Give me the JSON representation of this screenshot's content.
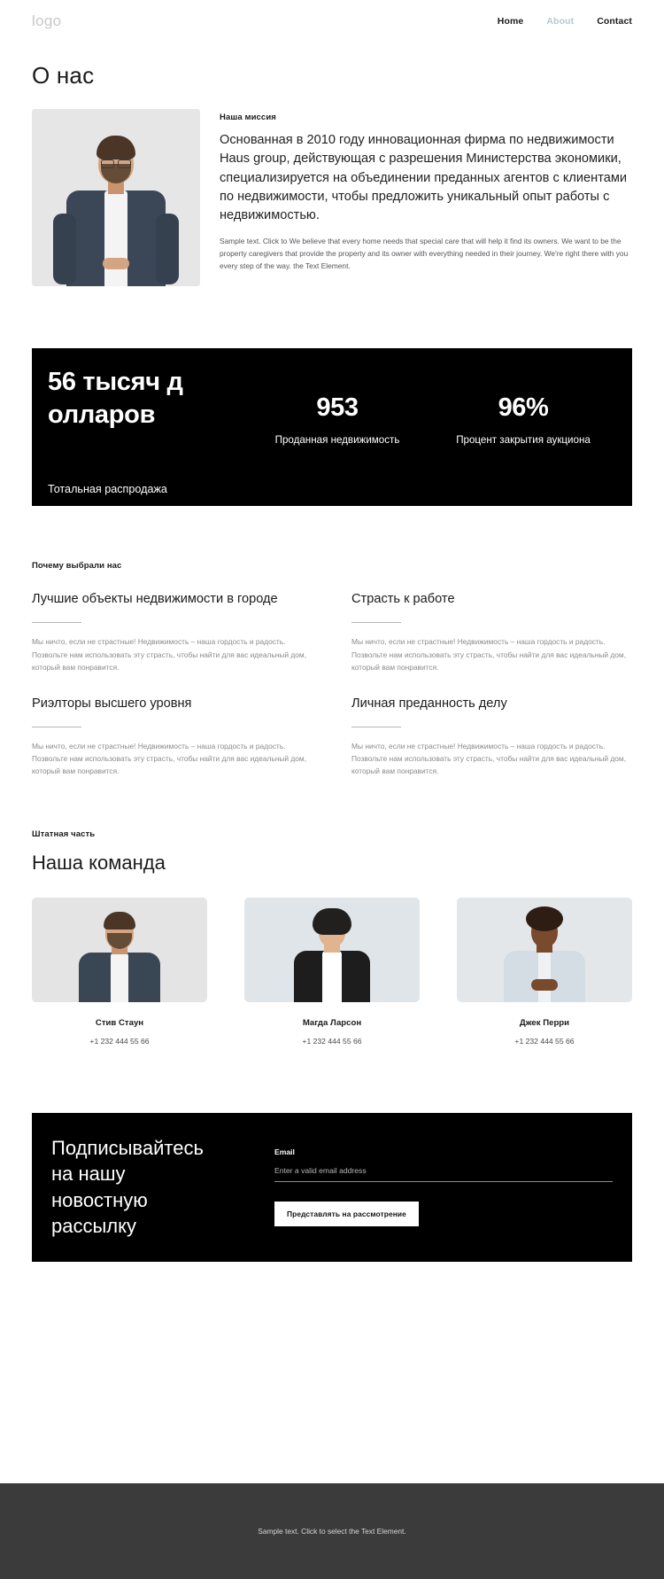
{
  "header": {
    "logo": "logo",
    "nav": [
      {
        "label": "Home",
        "active": false
      },
      {
        "label": "About",
        "active": true
      },
      {
        "label": "Contact",
        "active": false
      }
    ]
  },
  "page": {
    "title": "О нас"
  },
  "about": {
    "eyebrow": "Наша миссия",
    "lead": "Основанная в 2010 году инновационная фирма по недвижимости Haus group, действующая с разрешения Министерства экономики, специализируется на объединении преданных агентов с клиентами по недвижимости, чтобы предложить уникальный опыт работы с недвижимостью.",
    "small": "Sample text. Click to We believe that every home needs that special care that will help it find its owners. We want to be the property caregivers that provide the property and its owner with everything needed in their journey. We're right there with you every step of the way. the Text Element.",
    "photo_alt": "portrait-man-glasses"
  },
  "stats": {
    "main": {
      "value": "56 тысяч долларов",
      "label": "Тотальная распродажа"
    },
    "items": [
      {
        "value": "953",
        "label": "Проданная недвижимость"
      },
      {
        "value": "96%",
        "label": "Процент закрытия аукциона"
      }
    ],
    "background_color": "#000000"
  },
  "why": {
    "eyebrow": "Почему выбрали нас",
    "items": [
      {
        "title": "Лучшие объекты недвижимости в городе",
        "text": "Мы ничто, если не страстные! Недвижимость – наша гордость и радость. Позвольте нам использовать эту страсть, чтобы найти для вас идеальный дом, который вам понравится."
      },
      {
        "title": "Страсть к работе",
        "text": "Мы ничто, если не страстные! Недвижимость – наша гордость и радость. Позвольте нам использовать эту страсть, чтобы найти для вас идеальный дом, который вам понравится."
      },
      {
        "title": "Риэлторы высшего уровня",
        "text": "Мы ничто, если не страстные! Недвижимость – наша гордость и радость. Позвольте нам использовать эту страсть, чтобы найти для вас идеальный дом, который вам понравится."
      },
      {
        "title": "Личная преданность делу",
        "text": "Мы ничто, если не страстные! Недвижимость – наша гордость и радость. Позвольте нам использовать эту страсть, чтобы найти для вас идеальный дом, который вам понравится."
      }
    ]
  },
  "team": {
    "eyebrow": "Штатная часть",
    "title": "Наша команда",
    "members": [
      {
        "name": "Стив Стаун",
        "phone": "+1 232 444 55 66",
        "photo_alt": "portrait-man-beard"
      },
      {
        "name": "Магда Ларсон",
        "phone": "+1 232 444 55 66",
        "photo_alt": "portrait-woman-curly"
      },
      {
        "name": "Джек Перри",
        "phone": "+1 232 444 55 66",
        "photo_alt": "portrait-man-smiling"
      }
    ]
  },
  "newsletter": {
    "title_line1": "Подписывайтесь",
    "title_line2": "на нашу",
    "title_line3": "новостную",
    "title_line4": "рассылку",
    "email_label": "Email",
    "email_placeholder": "Enter a valid email address",
    "email_value": "",
    "submit_label": "Представлять на рассмотрение",
    "background_color": "#000000"
  },
  "footer": {
    "text": "Sample text. Click to select the Text Element.",
    "background_color": "#3b3b3b"
  }
}
